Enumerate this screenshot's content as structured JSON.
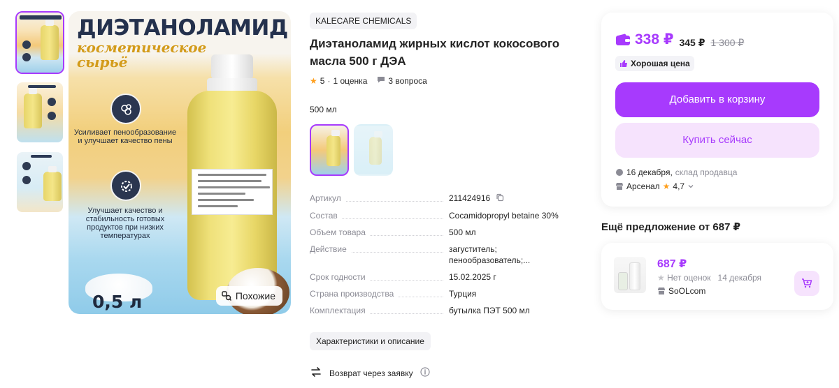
{
  "gallery": {
    "main_image": {
      "headline": "ДИЭТАНОЛАМИД",
      "subline_1": "косметическое",
      "subline_2": "сырьё",
      "benefit_1": "Усиливает пенообразование и улучшает качество пены",
      "benefit_2": "Улучшает качество и стабильность готовых продуктов при низких температурах",
      "volume": "0,5 л"
    },
    "similar_button": "Похожие"
  },
  "product": {
    "brand": "KALECARE CHEMICALS",
    "title": "Диэтаноламид жирных кислот кокосового масла 500 г ДЭА",
    "rating": "5",
    "rating_count": "1 оценка",
    "questions": "3 вопроса",
    "variant_label": "500 мл"
  },
  "specs": [
    {
      "key": "Артикул",
      "value": "211424916"
    },
    {
      "key": "Состав",
      "value": "Cocamidopropyl betaine 30%"
    },
    {
      "key": "Объем товара",
      "value": "500 мл"
    },
    {
      "key": "Действие",
      "value": "загуститель; пенообразователь;..."
    },
    {
      "key": "Срок годности",
      "value": "15.02.2025 г"
    },
    {
      "key": "Страна производства",
      "value": "Турция"
    },
    {
      "key": "Комплектация",
      "value": "бутылка ПЭТ 500 мл"
    }
  ],
  "chars_button": "Характеристики и описание",
  "return_text": "Возврат через заявку",
  "buy": {
    "price": "338 ₽",
    "price_alt": "345 ₽",
    "price_old": "1 300 ₽",
    "badge": "Хорошая цена",
    "cart_button": "Добавить в корзину",
    "buy_button": "Купить сейчас",
    "delivery_date": "16 декабря,",
    "delivery_source": "склад продавца",
    "seller_name": "Арсенал",
    "seller_rating": "4,7"
  },
  "more_offers": {
    "title": "Ещё предложение от 687 ₽",
    "price": "687 ₽",
    "no_ratings": "Нет оценок",
    "date": "14 декабря",
    "seller": "SoOLcom"
  },
  "colors": {
    "accent": "#a73afd",
    "accent_light": "#f6e3fd",
    "star": "#ff9f1c"
  }
}
